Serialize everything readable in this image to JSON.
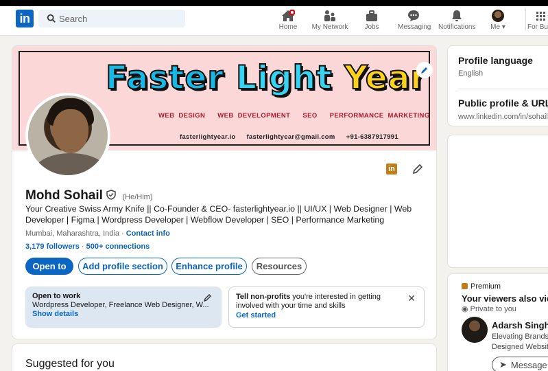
{
  "nav": {
    "search_placeholder": "Search",
    "items": [
      {
        "label": "Home",
        "icon": "home-icon"
      },
      {
        "label": "My Network",
        "icon": "network-icon"
      },
      {
        "label": "Jobs",
        "icon": "briefcase-icon"
      },
      {
        "label": "Messaging",
        "icon": "messaging-icon"
      },
      {
        "label": "Notifications",
        "icon": "bell-icon"
      },
      {
        "label": "Me",
        "icon": "avatar-icon"
      },
      {
        "label": "For Busi",
        "icon": "grid-icon"
      }
    ]
  },
  "banner": {
    "title_part1": "Faster",
    "title_part2": "Light",
    "title_part3": "Year",
    "services": [
      "WEB DESIGN",
      "WEB DEVELOPMENT",
      "SEO",
      "PERFORMANCE MARKETING"
    ],
    "contact": [
      "fasterlightyear.io",
      "fasterlightyear@gmail.com",
      "+91-6387917991"
    ]
  },
  "profile": {
    "name": "Mohd Sohail",
    "pronouns": "(He/Him)",
    "headline": "Your Creative Swiss Army Knife || Co-Founder & CEO- fasterlightyear.io || UI/UX | Web Designer | Web Developer | Figma | Wordpress Developer | Webflow Developer | SEO | Performance Marketing",
    "location": "Mumbai, Maharashtra, India",
    "location_sep": " · ",
    "contact_info": "Contact info",
    "followers": "3,179 followers",
    "connections_sep": " · ",
    "connections": "500+ connections",
    "buttons": {
      "open_to": "Open to",
      "add_section": "Add profile section",
      "enhance": "Enhance profile",
      "resources": "Resources"
    },
    "open_to_work": {
      "title": "Open to work",
      "roles": "Wordpress Developer, Freelance Web Designer, W...",
      "link": "Show details"
    },
    "nonprofits": {
      "bold": "Tell non-profits",
      "text": " you're interested in getting involved with your time and skills",
      "link": "Get started"
    }
  },
  "suggested": {
    "title": "Suggested for you"
  },
  "sidebar": {
    "profile_language_title": "Profile language",
    "profile_language_value": "English",
    "public_profile_title": "Public profile & URL",
    "public_profile_url": "www.linkedin.com/in/sohaill",
    "premium_label": "Premium",
    "viewers_title": "Your viewers also viewe",
    "private_label": "Private to you",
    "viewer_name": "Adarsh Singh ·",
    "viewer_desc1": "Elevating Brands T",
    "viewer_desc2": "Designed Website",
    "message_label": "Message"
  },
  "colors": {
    "brand": "#0a66c2",
    "banner_bg": "#fbd7d7",
    "premium": "#c37d16"
  }
}
